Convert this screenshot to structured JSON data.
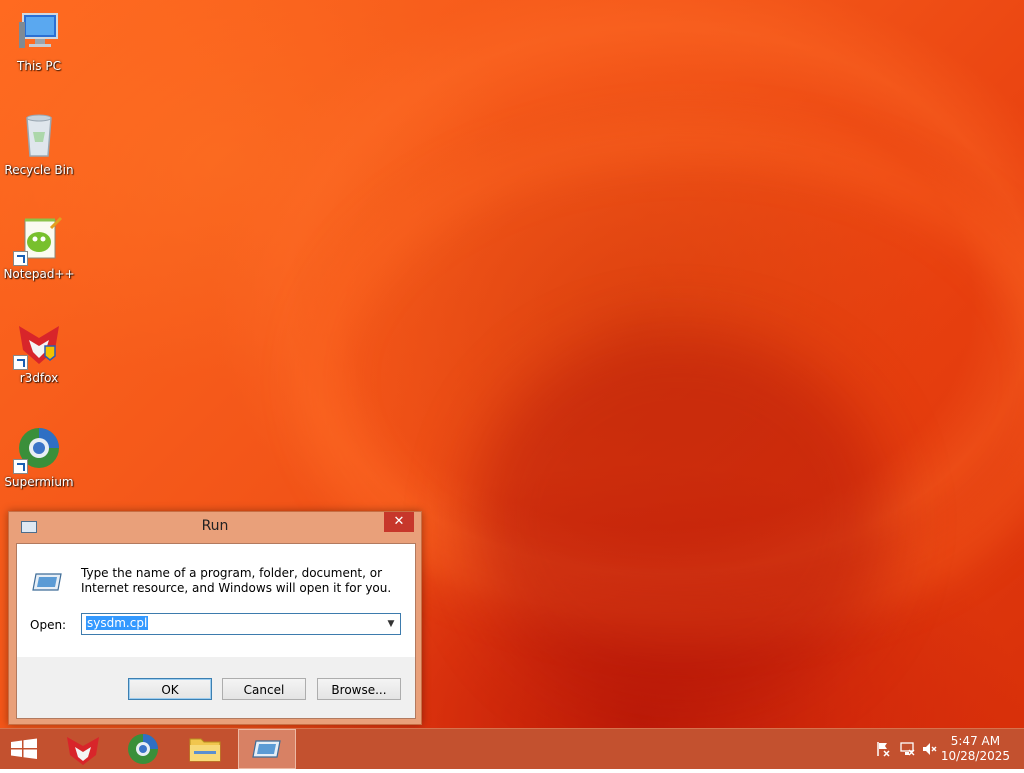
{
  "desktop": {
    "icons": [
      {
        "label": "This PC",
        "icon": "computer-icon"
      },
      {
        "label": "Recycle Bin",
        "icon": "recycle-bin-icon"
      },
      {
        "label": "Notepad++",
        "icon": "notepad-plus-plus-icon"
      },
      {
        "label": "r3dfox",
        "icon": "r3dfox-icon"
      },
      {
        "label": "Supermium",
        "icon": "supermium-icon"
      }
    ]
  },
  "run_dialog": {
    "title": "Run",
    "close_glyph": "✕",
    "description": "Type the name of a program, folder, document, or Internet resource, and Windows will open it for you.",
    "open_label": "Open:",
    "open_value": "sysdm.cpl",
    "ok_label": "OK",
    "cancel_label": "Cancel",
    "browse_label": "Browse..."
  },
  "taskbar": {
    "items": [
      "start-button",
      "r3dfox",
      "supermium",
      "file-explorer",
      "run"
    ],
    "active": "run",
    "clock": {
      "time": "5:47 AM",
      "date": "10/28/2025"
    }
  },
  "colors": {
    "wallpaper": "#f25418",
    "taskbar": "#c04824",
    "dialog_frame": "#e9a07a",
    "close_button": "#c7372b",
    "selection": "#3399ff"
  }
}
